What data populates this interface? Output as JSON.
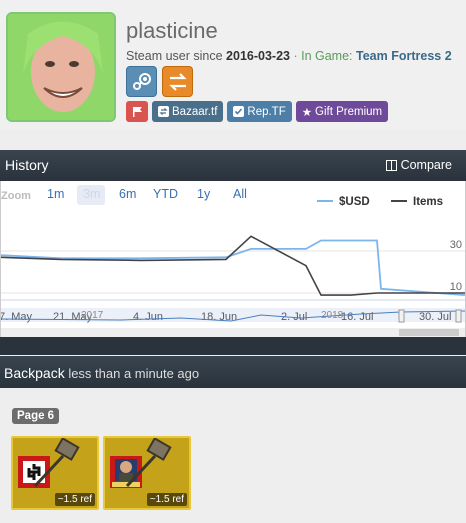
{
  "profile": {
    "username": "plasticine",
    "since_prefix": "Steam user since ",
    "since_date": "2016-03-23",
    "ingame_prefix": " · In Game: ",
    "game": "Team Fortress 2",
    "badges": {
      "bazaar": "Bazaar.tf",
      "rep": "Rep.TF",
      "gift": "Gift Premium"
    }
  },
  "history": {
    "title": "History",
    "compare_label": "Compare",
    "zoom_label": "Zoom",
    "zoom_options": [
      "1m",
      "3m",
      "6m",
      "YTD",
      "1y",
      "All"
    ],
    "selected_zoom": "3m",
    "legend": [
      {
        "name": "$USD",
        "color": "#7cb5ec"
      },
      {
        "name": "Items",
        "color": "#434348"
      }
    ]
  },
  "chart_data": {
    "type": "line",
    "x_labels": [
      "7. May",
      "21. May",
      "4. Jun",
      "18. Jun",
      "2. Jul",
      "16. Jul",
      "30. Jul"
    ],
    "navigator_labels": [
      "2017",
      "2018"
    ],
    "y_ticks": [
      10,
      30
    ],
    "series": [
      {
        "name": "$USD",
        "values": [
          28,
          26.5,
          26.5,
          27,
          31,
          31,
          35,
          35,
          35,
          12,
          9
        ]
      },
      {
        "name": "Items",
        "values": [
          27,
          26,
          25.5,
          26,
          37,
          23,
          9,
          9,
          10,
          10,
          10
        ]
      }
    ],
    "grid": true,
    "legend_position": "top-right"
  },
  "backpack": {
    "title": "Backpack",
    "updated": " less than a minute ago",
    "page_label": "Page 6",
    "items": [
      {
        "price": "~1.5 ref"
      },
      {
        "price": "~1.5 ref"
      }
    ]
  }
}
